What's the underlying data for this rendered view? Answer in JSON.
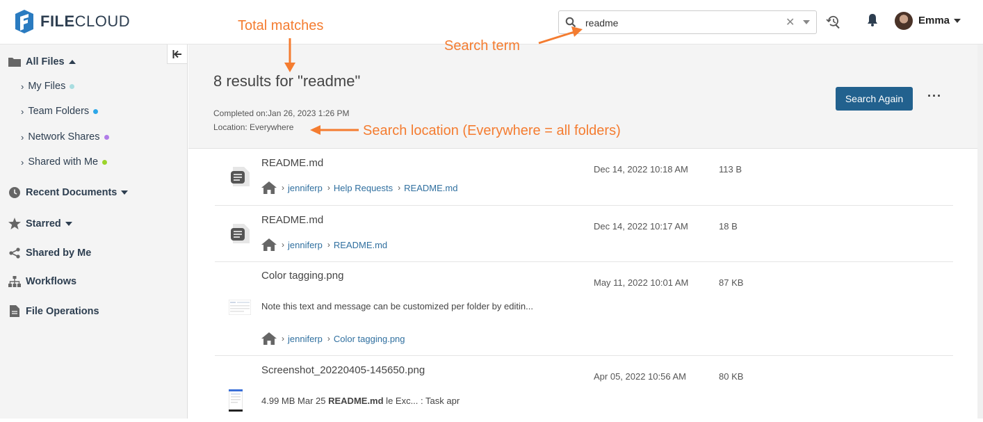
{
  "app": {
    "logo_text_bold": "FILE",
    "logo_text_light": "CLOUD"
  },
  "search": {
    "value": "readme",
    "placeholder": "Search"
  },
  "user": {
    "name": "Emma"
  },
  "sidebar": {
    "all_files": "All Files",
    "sub_items": [
      {
        "label": "My Files",
        "color": "#a8dde0"
      },
      {
        "label": "Team Folders",
        "color": "#2da7e8"
      },
      {
        "label": "Network Shares",
        "color": "#b07ce8"
      },
      {
        "label": "Shared with Me",
        "color": "#9bd42a"
      }
    ],
    "recent": "Recent Documents",
    "starred": "Starred",
    "shared_by_me": "Shared by Me",
    "workflows": "Workflows",
    "file_operations": "File Operations"
  },
  "summary": {
    "title": "8 results for \"readme\"",
    "completed": "Completed on:Jan 26, 2023 1:26 PM",
    "location": "Location: Everywhere",
    "search_again": "Search Again",
    "more": "···"
  },
  "results": [
    {
      "name": "README.md",
      "date": "Dec 14, 2022 10:18 AM",
      "size": "113 B",
      "path": [
        "jenniferp",
        "Help Requests",
        "README.md"
      ]
    },
    {
      "name": "README.md",
      "date": "Dec 14, 2022 10:17 AM",
      "size": "18 B",
      "path": [
        "jenniferp",
        "README.md"
      ]
    },
    {
      "name": "Color tagging.png",
      "date": "May 11, 2022 10:01 AM",
      "size": "87 KB",
      "snippet": "Note this text and message can be customized per folder by editin...",
      "path": [
        "jenniferp",
        "Color tagging.png"
      ]
    },
    {
      "name": "Screenshot_20220405-145650.png",
      "date": "Apr 05, 2022 10:56 AM",
      "size": "80 KB",
      "snippet_pre": "4.99 MB Mar 25 ",
      "snippet_bold": "README.md",
      "snippet_post": " le Exc... : Task apr"
    }
  ],
  "annotations": {
    "total_matches": "Total matches",
    "search_term": "Search term",
    "search_location": "Search location (Everywhere = all folders)"
  },
  "colors": {
    "accent": "#22618e",
    "annotation": "#f47c30",
    "link": "#2f6f9f"
  }
}
